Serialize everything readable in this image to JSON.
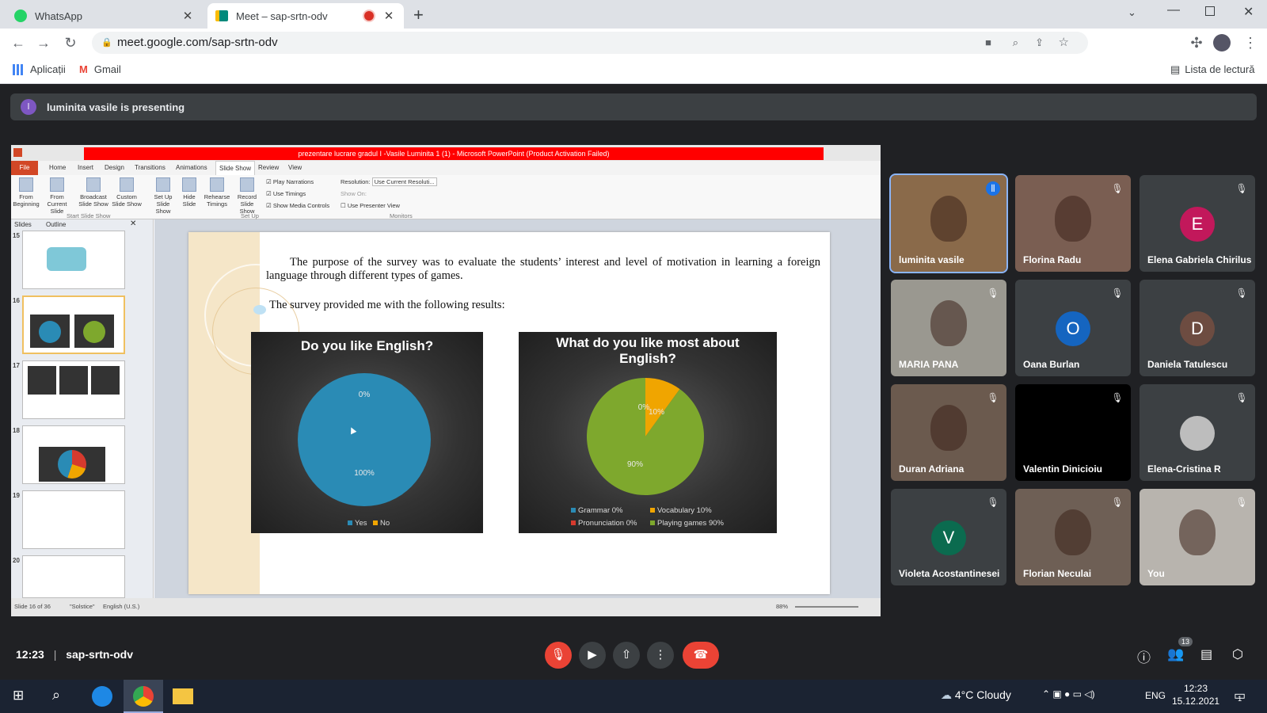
{
  "browser": {
    "tabs": [
      {
        "title": "WhatsApp",
        "icon": "whatsapp-icon",
        "active": false
      },
      {
        "title": "Meet – sap-srtn-odv",
        "icon": "google-meet-icon",
        "active": true,
        "recording": true
      }
    ],
    "url": "meet.google.com/sap-srtn-odv",
    "bookmarks": [
      {
        "label": "Aplicații",
        "icon": "apps-grid-icon"
      },
      {
        "label": "Gmail",
        "icon": "gmail-icon"
      }
    ],
    "reading_list": "Lista de lectură"
  },
  "meet": {
    "presenter_initial": "l",
    "presenting_text": "luminita vasile is presenting",
    "time": "12:23",
    "meeting_code": "sap-srtn-odv",
    "people_count": "13",
    "participants": [
      {
        "name": "luminita vasile",
        "type": "video",
        "speaking": true
      },
      {
        "name": "Florina Radu",
        "type": "video",
        "muted": true
      },
      {
        "name": "Elena Gabriela Chirilus",
        "type": "avatar",
        "initial": "E",
        "color": "#c2185b",
        "muted": true
      },
      {
        "name": "MARIA PANA",
        "type": "video",
        "muted": true
      },
      {
        "name": "Oana Burlan",
        "type": "avatar",
        "initial": "O",
        "color": "#1565c0",
        "muted": true
      },
      {
        "name": "Daniela Tatulescu",
        "type": "avatar",
        "initial": "D",
        "color": "#6d4c41",
        "muted": true
      },
      {
        "name": "Duran Adriana",
        "type": "video",
        "muted": true
      },
      {
        "name": "Valentin Dinicioiu",
        "type": "video-off",
        "muted": true
      },
      {
        "name": "Elena-Cristina R",
        "type": "photo",
        "muted": true
      },
      {
        "name": "Violeta Acostantinesei",
        "type": "avatar",
        "initial": "V",
        "color": "#0b6b4f",
        "muted": true
      },
      {
        "name": "Florian Neculai",
        "type": "video",
        "muted": true
      },
      {
        "name": "You",
        "type": "video",
        "muted": true
      }
    ]
  },
  "powerpoint": {
    "window_title": "prezentare lucrare gradul I -Vasile   Luminita 1 (1)  -  Microsoft PowerPoint (Product Activation Failed)",
    "ribbon_tabs": [
      "File",
      "Home",
      "Insert",
      "Design",
      "Transitions",
      "Animations",
      "Slide Show",
      "Review",
      "View"
    ],
    "ribbon_buttons": [
      "From Beginning",
      "From Current Slide",
      "Broadcast Slide Show",
      "Custom Slide Show",
      "Set Up Slide Show",
      "Hide Slide",
      "Rehearse Timings",
      "Record Slide Show"
    ],
    "checkboxes": [
      "Play Narrations",
      "Use Timings",
      "Show Media Controls"
    ],
    "resolution_label": "Resolution:",
    "resolution_value": "Use Current Resoluti...",
    "show_on_label": "Show On:",
    "presenter_view": "Use Presenter View",
    "groups": [
      "Start Slide Show",
      "Set Up",
      "Monitors"
    ],
    "panel_tabs": [
      "Slides",
      "Outline"
    ],
    "slide_numbers": [
      "15",
      "16",
      "17",
      "18",
      "19",
      "20"
    ],
    "status_slide": "Slide 16 of 36",
    "status_theme": "\"Solstice\"",
    "status_lang": "English (U.S.)",
    "zoom": "88%"
  },
  "slide": {
    "paragraph1": "The purpose of the survey was to evaluate the students’ interest and level of motivation in learning a foreign language through different types of games.",
    "paragraph2": "The survey provided me with the following results:"
  },
  "chart_data": [
    {
      "type": "pie",
      "title": "Do you like English?",
      "categories": [
        "Yes",
        "No"
      ],
      "values": [
        100,
        0
      ],
      "labels": [
        "100%",
        "0%"
      ],
      "colors": [
        "#2a8bb5",
        "#f0a500"
      ]
    },
    {
      "type": "pie",
      "title": "What do you like most about English?",
      "categories": [
        "Grammar",
        "Vocabulary",
        "Pronunciation",
        "Playing games"
      ],
      "values": [
        0,
        10,
        0,
        90
      ],
      "labels": [
        "Grammar 0%",
        "Vocabulary 10%",
        "Pronunciation 0%",
        "Playing games 90%"
      ],
      "slice_labels": [
        "0%",
        "10%",
        "0%",
        "90%"
      ],
      "colors": [
        "#2a8bb5",
        "#f0a500",
        "#d63a2e",
        "#7ea82d"
      ]
    }
  ],
  "taskbar": {
    "weather": "4°C  Cloudy",
    "lang": "ENG",
    "time": "12:23",
    "date": "15.12.2021",
    "notifications": "1"
  }
}
